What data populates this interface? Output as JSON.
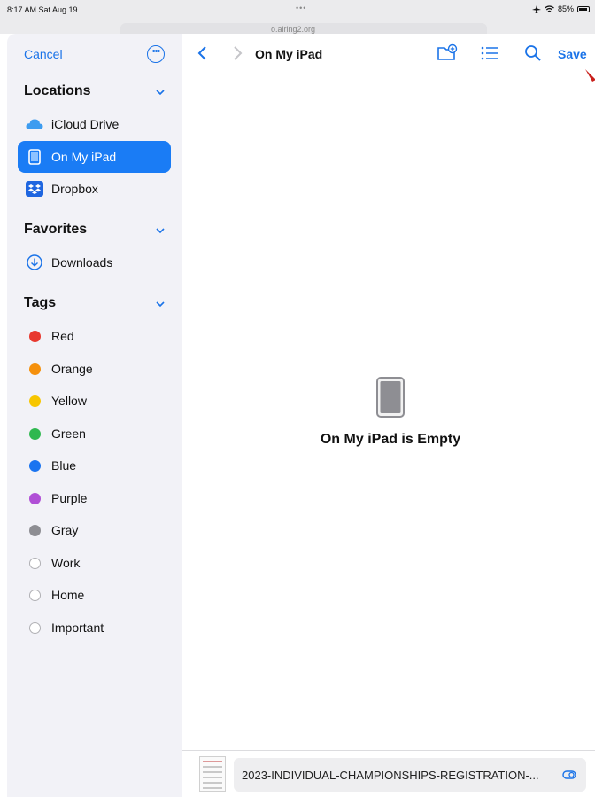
{
  "status_bar": {
    "time": "8:17 AM  Sat Aug 19",
    "center_dots": "•••",
    "battery_percent": "85%"
  },
  "browser_behind": {
    "url_partial": "o.airing2.org"
  },
  "sidebar": {
    "cancel_label": "Cancel",
    "more_icon": "ellipsis-circle-icon",
    "locations": {
      "heading": "Locations",
      "items": [
        {
          "label": "iCloud Drive",
          "icon": "icloud-icon"
        },
        {
          "label": "On My iPad",
          "icon": "ipad-icon",
          "selected": true
        },
        {
          "label": "Dropbox",
          "icon": "dropbox-icon"
        }
      ]
    },
    "favorites": {
      "heading": "Favorites",
      "items": [
        {
          "label": "Downloads",
          "icon": "download-circle-icon"
        }
      ]
    },
    "tags": {
      "heading": "Tags",
      "items": [
        {
          "label": "Red",
          "color": "#e8382e"
        },
        {
          "label": "Orange",
          "color": "#f5900c"
        },
        {
          "label": "Yellow",
          "color": "#f7c600"
        },
        {
          "label": "Green",
          "color": "#2fb84f"
        },
        {
          "label": "Blue",
          "color": "#1a74f0"
        },
        {
          "label": "Purple",
          "color": "#b04fd6"
        },
        {
          "label": "Gray",
          "color": "#8e8e93"
        },
        {
          "label": "Work",
          "color": ""
        },
        {
          "label": "Home",
          "color": ""
        },
        {
          "label": "Important",
          "color": ""
        }
      ]
    }
  },
  "main": {
    "title": "On My iPad",
    "save_label": "Save",
    "empty_message": "On My iPad is Empty",
    "toolbar_icons": [
      "new-folder-icon",
      "list-view-icon",
      "search-icon"
    ]
  },
  "bottom": {
    "filename": "2023-INDIVIDUAL-CHAMPIONSHIPS-REGISTRATION-..."
  },
  "colors": {
    "accent": "#1a73e8",
    "selected_bg": "#1a7cf5",
    "sidebar_bg": "#f2f2f7"
  }
}
